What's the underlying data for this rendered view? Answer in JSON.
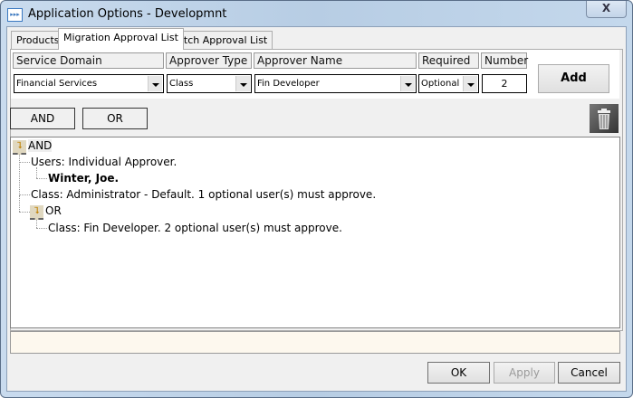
{
  "window": {
    "title": "Application Options - Developmnt",
    "close_label": "X"
  },
  "tabs": [
    {
      "label": "Products"
    },
    {
      "label": "Migration Approval List"
    },
    {
      "label": "Patch Approval List"
    }
  ],
  "form": {
    "headers": {
      "service_domain": "Service Domain",
      "approver_type": "Approver Type",
      "approver_name": "Approver Name",
      "required": "Required",
      "number": "Number"
    },
    "values": {
      "service_domain": "Financial Services",
      "approver_type": "Class",
      "approver_name": "Fin Developer",
      "required": "Optional",
      "number": "2"
    },
    "add_label": "Add"
  },
  "logic_buttons": {
    "and": "AND",
    "or": "OR"
  },
  "tree": {
    "root": "AND",
    "users": "Users: Individual Approver.",
    "user": "Winter, Joe.",
    "class_admin": "Class: Administrator - Default. 1 optional user(s) must approve.",
    "or_node": "OR",
    "class_fin": "Class: Fin Developer. 2 optional user(s) must approve."
  },
  "footer": {
    "ok": "OK",
    "apply": "Apply",
    "cancel": "Cancel"
  }
}
